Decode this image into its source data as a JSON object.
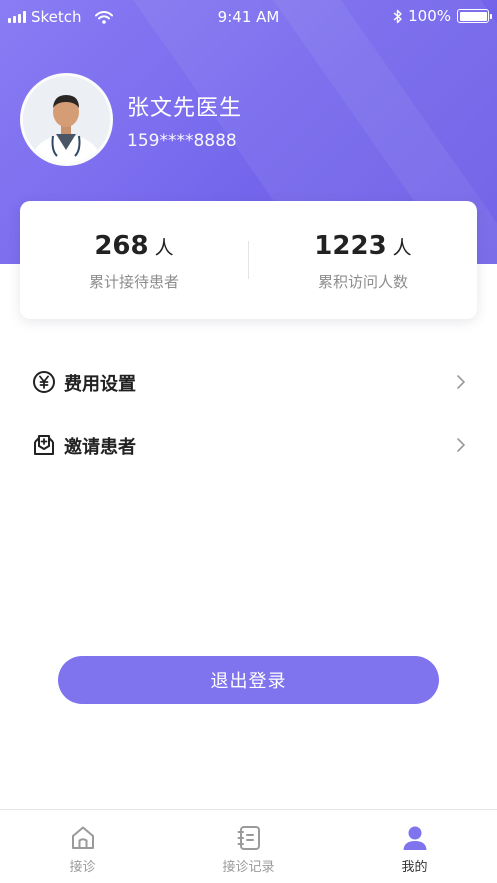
{
  "status_bar": {
    "carrier": "Sketch",
    "time": "9:41 AM",
    "battery": "100%"
  },
  "profile": {
    "name": "张文先医生",
    "phone": "159****8888"
  },
  "stats": [
    {
      "value": "268",
      "unit": "人",
      "label": "累计接待患者"
    },
    {
      "value": "1223",
      "unit": "人",
      "label": "累积访问人数"
    }
  ],
  "menu": [
    {
      "label": "费用设置",
      "icon": "yen-circle-icon"
    },
    {
      "label": "邀请患者",
      "icon": "invite-patient-icon"
    }
  ],
  "logout_label": "退出登录",
  "tabbar": {
    "tabs": [
      {
        "label": "接诊",
        "icon": "home-icon"
      },
      {
        "label": "接诊记录",
        "icon": "records-icon"
      },
      {
        "label": "我的",
        "icon": "person-icon"
      }
    ],
    "active_tab": "我的"
  },
  "colors": {
    "accent": "#7f74ee",
    "header_gradient_start": "#8a7cf3",
    "header_gradient_end": "#6a5be6"
  }
}
